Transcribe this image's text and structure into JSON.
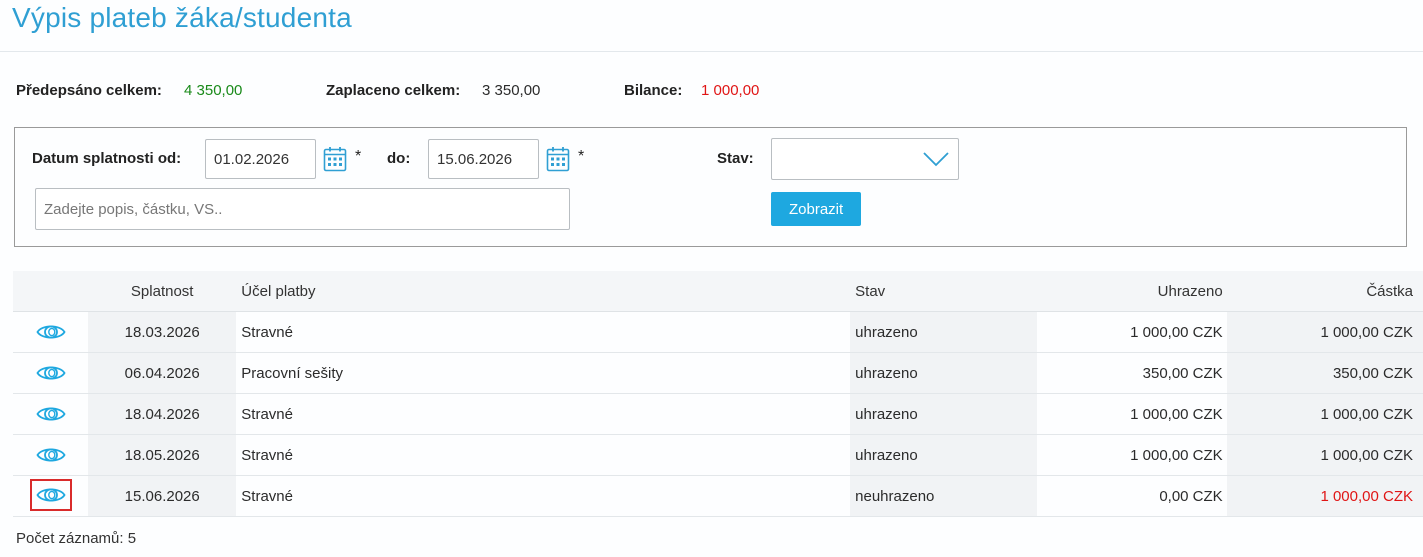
{
  "page": {
    "title": "Výpis plateb žáka/studenta"
  },
  "summary": {
    "prescribed_label": "Předepsáno celkem:",
    "prescribed_value": "4 350,00",
    "paid_label": "Zaplaceno celkem:",
    "paid_value": "3 350,00",
    "balance_label": "Bilance:",
    "balance_value": "1 000,00"
  },
  "filter": {
    "date_from_label": "Datum splatnosti od:",
    "date_from_value": "01.02.2026",
    "date_to_label": "do:",
    "date_to_value": "15.06.2026",
    "required_mark": "*",
    "state_label": "Stav:",
    "state_value": "",
    "search_placeholder": "Zadejte popis, částku, VS..",
    "search_value": "",
    "submit_label": "Zobrazit"
  },
  "table": {
    "headers": {
      "due": "Splatnost",
      "purpose": "Účel platby",
      "state": "Stav",
      "paid": "Uhrazeno",
      "amount": "Částka"
    },
    "rows": [
      {
        "due": "18.03.2026",
        "purpose": "Stravné",
        "state": "uhrazeno",
        "paid": "1 000,00 CZK",
        "amount": "1 000,00 CZK"
      },
      {
        "due": "06.04.2026",
        "purpose": "Pracovní sešity",
        "state": "uhrazeno",
        "paid": "350,00 CZK",
        "amount": "350,00 CZK"
      },
      {
        "due": "18.04.2026",
        "purpose": "Stravné",
        "state": "uhrazeno",
        "paid": "1 000,00 CZK",
        "amount": "1 000,00 CZK"
      },
      {
        "due": "18.05.2026",
        "purpose": "Stravné",
        "state": "uhrazeno",
        "paid": "1 000,00 CZK",
        "amount": "1 000,00 CZK"
      },
      {
        "due": "15.06.2026",
        "purpose": "Stravné",
        "state": "neuhrazeno",
        "paid": "0,00 CZK",
        "amount": "1 000,00 CZK"
      }
    ]
  },
  "footer": {
    "count_text": "Počet záznamů: 5"
  },
  "icons": {
    "row_detail": "eye-icon",
    "date_picker": "calendar-icon",
    "select_arrow": "chevron-down-icon"
  },
  "colors": {
    "accent": "#1ea8e0",
    "title": "#2f9fd3",
    "positive": "#1a8a1a",
    "negative": "#e01515",
    "selection": "#d92b2b"
  }
}
